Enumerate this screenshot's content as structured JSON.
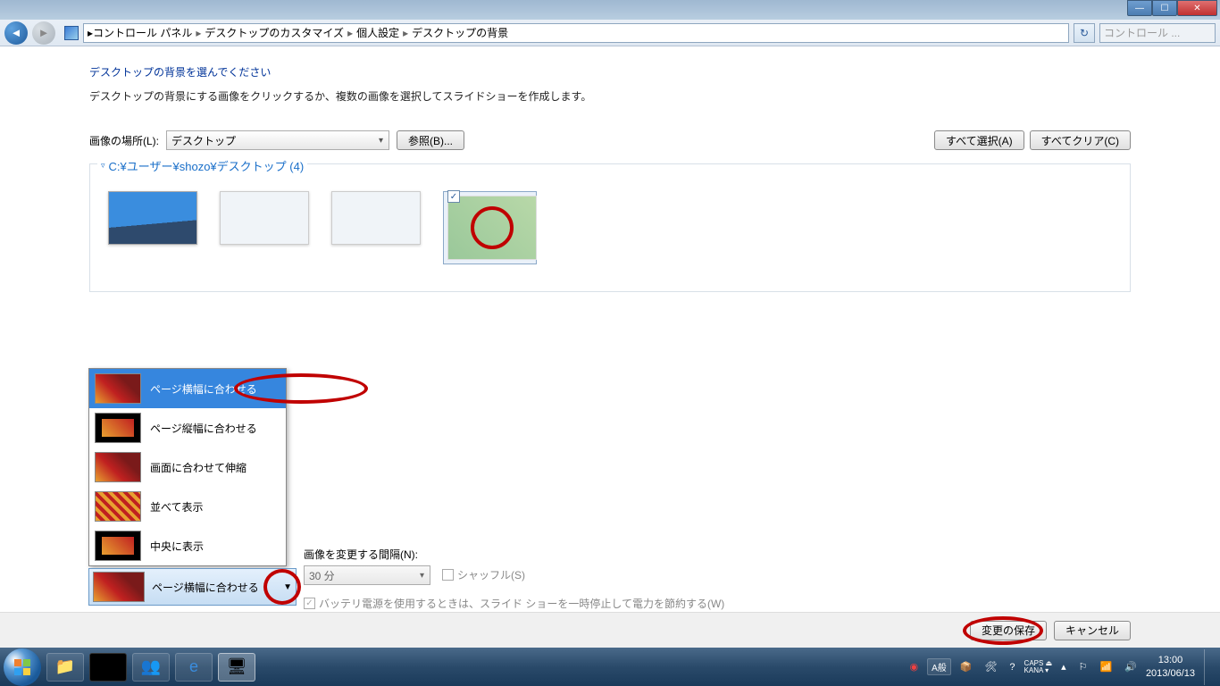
{
  "breadcrumb": {
    "items": [
      "コントロール パネル",
      "デスクトップのカスタマイズ",
      "個人設定",
      "デスクトップの背景"
    ]
  },
  "search": {
    "placeholder": "コントロール ..."
  },
  "page": {
    "heading": "デスクトップの背景を選んでください",
    "subtext": "デスクトップの背景にする画像をクリックするか、複数の画像を選択してスライドショーを作成します。"
  },
  "location": {
    "label": "画像の場所(L):",
    "value": "デスクトップ",
    "browse": "参照(B)..."
  },
  "buttons": {
    "select_all": "すべて選択(A)",
    "clear_all": "すべてクリア(C)",
    "save": "変更の保存",
    "cancel": "キャンセル"
  },
  "folder": {
    "path": "C:¥ユーザー¥shozo¥デスクトップ (4)"
  },
  "position": {
    "options": [
      "ページ横幅に合わせる",
      "ページ縦幅に合わせる",
      "画面に合わせて伸縮",
      "並べて表示",
      "中央に表示"
    ],
    "selected": "ページ横幅に合わせる"
  },
  "interval": {
    "label": "画像を変更する間隔(N):",
    "value": "30 分"
  },
  "shuffle": {
    "label": "シャッフル(S)"
  },
  "battery": {
    "label": "バッテリ電源を使用するときは、スライド ショーを一時停止して電力を節約する(W)"
  },
  "taskbar": {
    "ime": "A般",
    "caps": "CAPS",
    "kana": "KANA",
    "time": "13:00",
    "date": "2013/06/13"
  }
}
